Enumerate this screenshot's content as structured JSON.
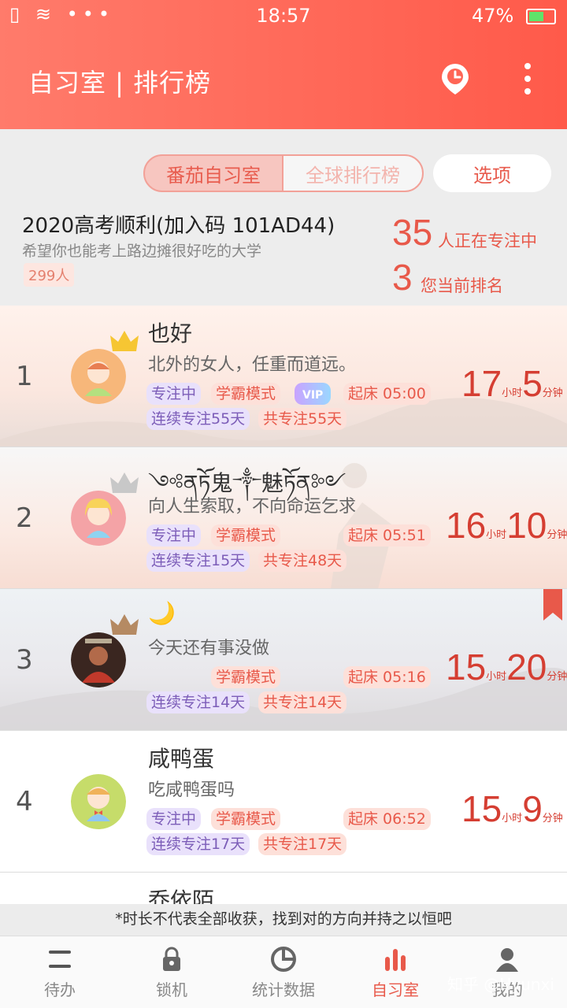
{
  "status": {
    "left": "▯ ≋ •••",
    "time": "18:57",
    "battery": "47%"
  },
  "header": {
    "title": "自习室 | 排行榜",
    "history_icon": "location-clock-icon",
    "menu_icon": "more-vertical-icon"
  },
  "tabs": [
    {
      "label": "番茄自习室",
      "active": true
    },
    {
      "label": "全球排行榜",
      "active": false
    }
  ],
  "options_button": "选项",
  "room": {
    "name": "2020高考顺利(加入码 101AD44)",
    "desc": "希望你也能考上路边摊很好吃的大学",
    "member_count": "299人",
    "focusing_num": "35",
    "focusing_label": "人正在专注中",
    "rank_num": "3",
    "rank_label": "您当前排名"
  },
  "rows": [
    {
      "rank": "1",
      "name": "也好",
      "motto": "北外的女人，任重而道远。",
      "focus_tag": "专注中",
      "mode_tag": "学霸模式",
      "vip_tag": "VIP",
      "wake_tag": "起床 05:00",
      "streak_tag": "连续专注55天",
      "total_tag": "共专注55天",
      "hours": "17",
      "hours_unit": "小时",
      "mins": "5",
      "mins_unit": "分钟"
    },
    {
      "rank": "2",
      "name": "༺ནཏོ鬼༒魅ཏོན༻",
      "motto": "向人生索取，不向命运乞求",
      "focus_tag": "专注中",
      "mode_tag": "学霸模式",
      "wake_tag": "起床 05:51",
      "streak_tag": "连续专注15天",
      "total_tag": "共专注48天",
      "hours": "16",
      "hours_unit": "小时",
      "mins": "10",
      "mins_unit": "分钟"
    },
    {
      "rank": "3",
      "name": "🌙",
      "motto": "今天还有事没做",
      "mode_tag": "学霸模式",
      "wake_tag": "起床 05:16",
      "streak_tag": "连续专注14天",
      "total_tag": "共专注14天",
      "hours": "15",
      "hours_unit": "小时",
      "mins": "20",
      "mins_unit": "分钟"
    },
    {
      "rank": "4",
      "name": "咸鸭蛋",
      "motto": "吃咸鸭蛋吗",
      "focus_tag": "专注中",
      "mode_tag": "学霸模式",
      "wake_tag": "起床 06:52",
      "streak_tag": "连续专注17天",
      "total_tag": "共专注17天",
      "hours": "15",
      "hours_unit": "小时",
      "mins": "9",
      "mins_unit": "分钟"
    },
    {
      "rank": "",
      "name": "乔依陌"
    }
  ],
  "footer_note": "*时长不代表全部收获，找到对的方向并持之以恒吧",
  "nav": [
    {
      "label": "待办",
      "icon": "list-icon"
    },
    {
      "label": "锁机",
      "icon": "lock-icon"
    },
    {
      "label": "统计数据",
      "icon": "pie-chart-icon"
    },
    {
      "label": "自习室",
      "icon": "bar-chart-icon",
      "active": true
    },
    {
      "label": "我的",
      "icon": "user-icon"
    }
  ],
  "watermark": "知乎 @Hyunxi",
  "colors": {
    "accent": "#e8594a",
    "header": "#ff6656"
  }
}
